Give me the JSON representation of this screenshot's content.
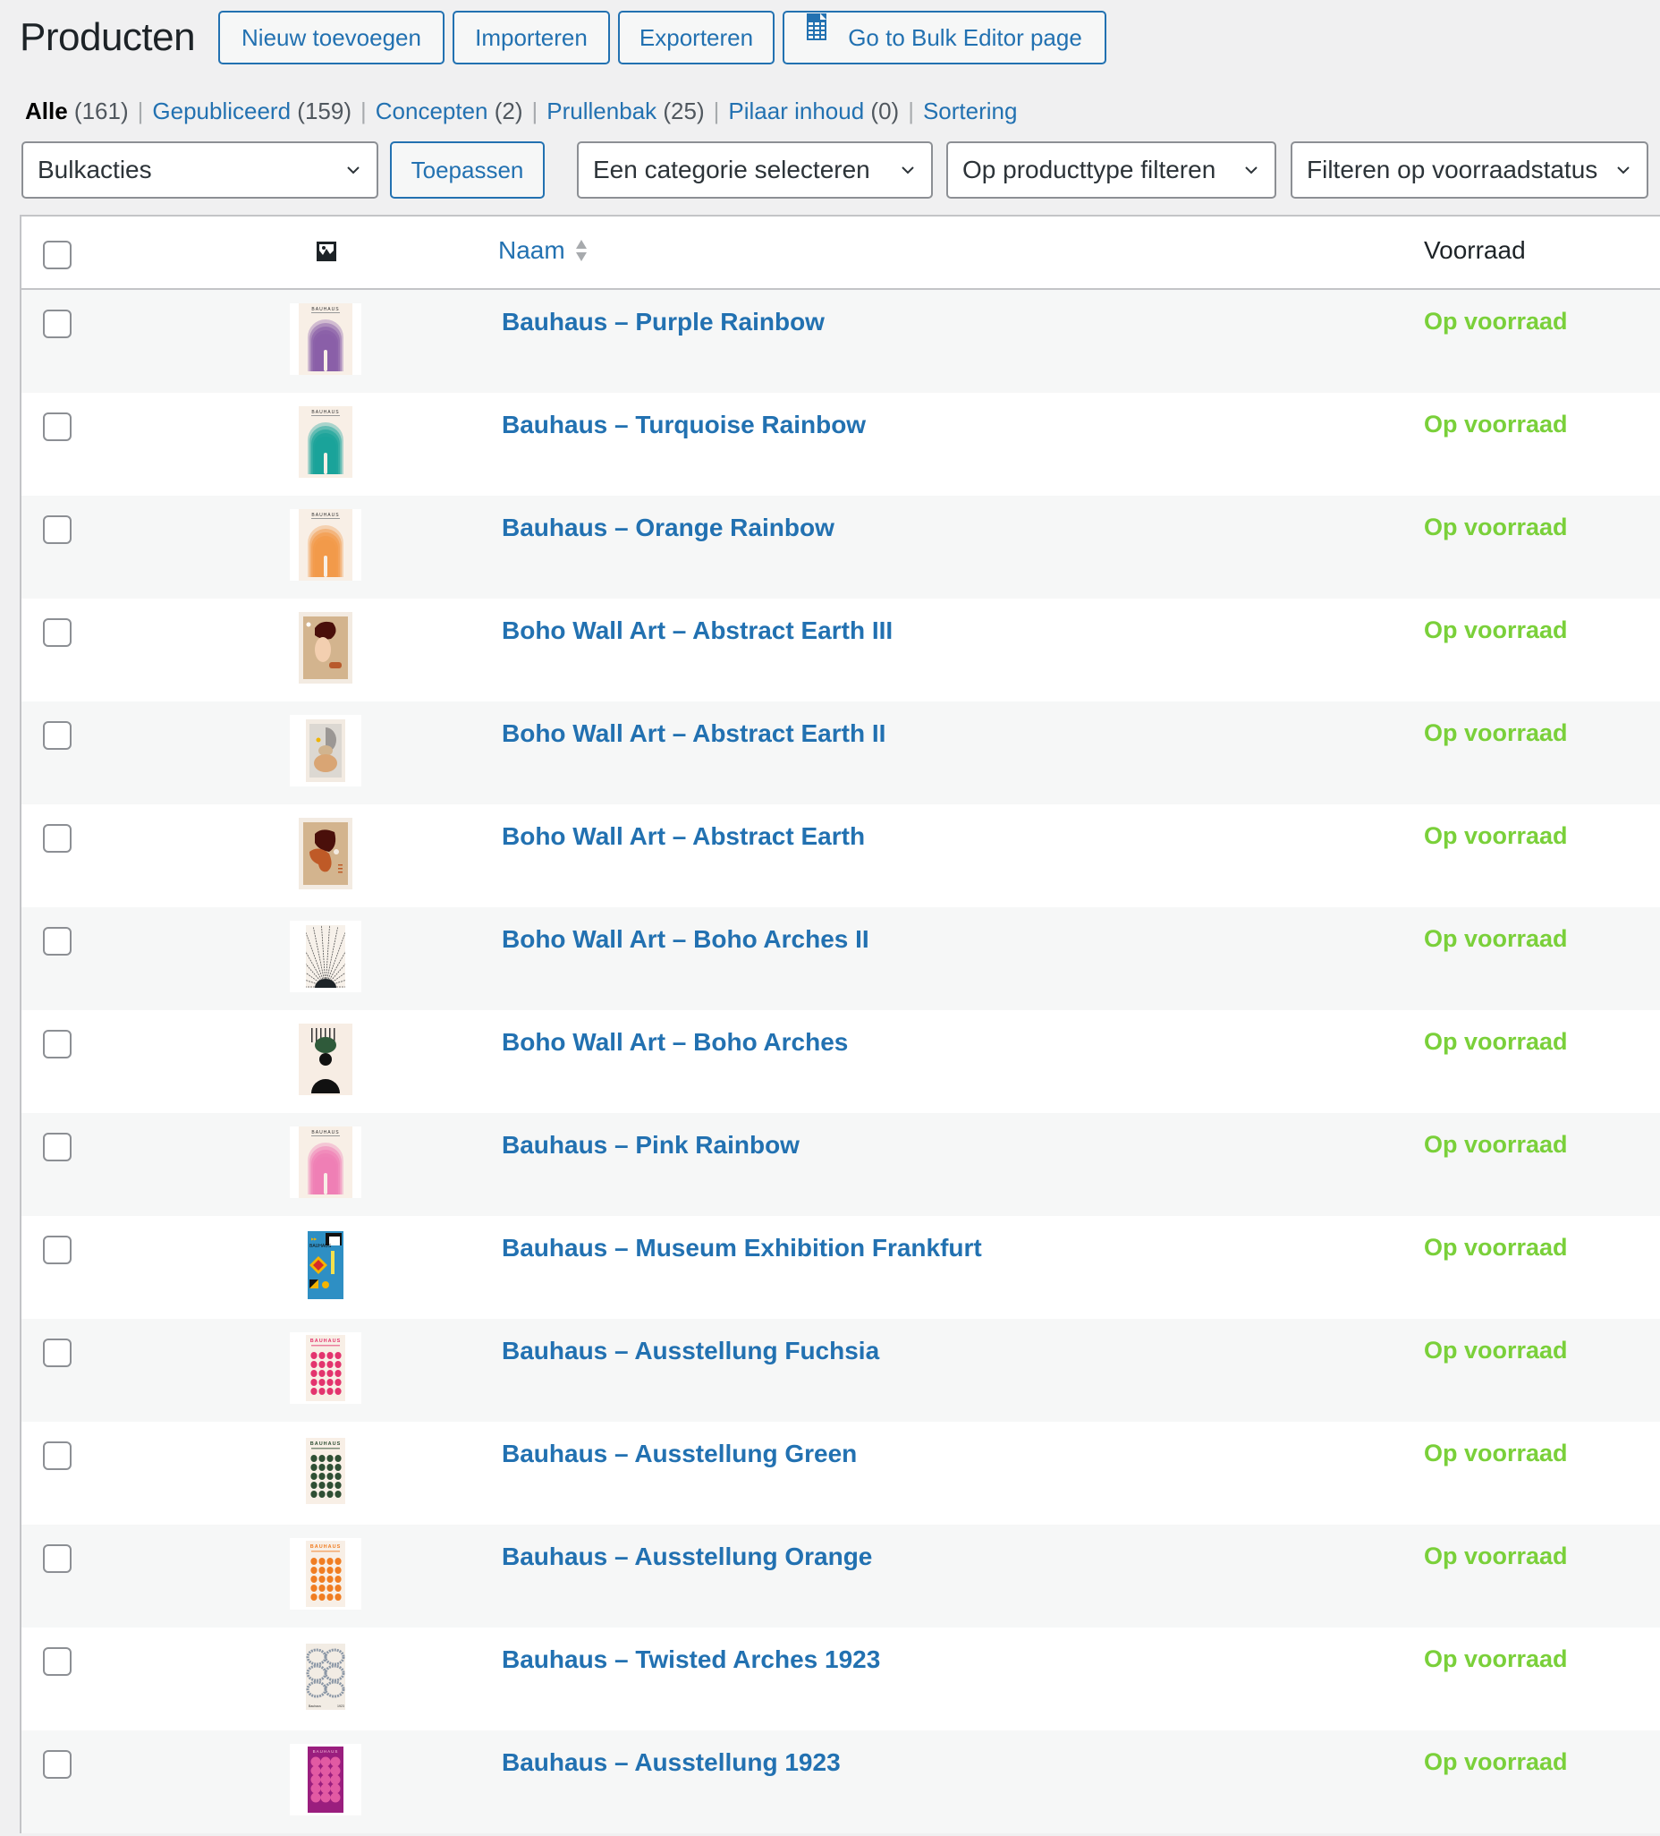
{
  "header": {
    "title": "Producten",
    "buttons": {
      "add_new": "Nieuw toevoegen",
      "import": "Importeren",
      "export": "Exporteren",
      "bulk_editor": "Go to Bulk Editor page",
      "bulk_editor_icon": "spreadsheet-icon"
    }
  },
  "views": [
    {
      "label": "Alle",
      "count": "(161)",
      "current": true
    },
    {
      "label": "Gepubliceerd",
      "count": "(159)"
    },
    {
      "label": "Concepten",
      "count": "(2)"
    },
    {
      "label": "Prullenbak",
      "count": "(25)"
    },
    {
      "label": "Pilaar inhoud",
      "count": "(0)"
    },
    {
      "label": "Sortering",
      "count": ""
    }
  ],
  "filters": {
    "bulk_actions": "Bulkacties",
    "apply": "Toepassen",
    "category": "Een categorie selecteren",
    "product_type": "Op producttype filteren",
    "stock_status": "Filteren op voorraadstatus"
  },
  "table": {
    "columns": {
      "image_icon": "image-icon",
      "name": "Naam",
      "stock": "Voorraad"
    },
    "rows": [
      {
        "name": "Bauhaus – Purple Rainbow",
        "stock": "Op voorraad",
        "thumb": "rainbow",
        "color": "#8a5fa8"
      },
      {
        "name": "Bauhaus – Turquoise Rainbow",
        "stock": "Op voorraad",
        "thumb": "rainbow",
        "color": "#1aa39a"
      },
      {
        "name": "Bauhaus – Orange Rainbow",
        "stock": "Op voorraad",
        "thumb": "rainbow",
        "color": "#f29a4a"
      },
      {
        "name": "Boho Wall Art – Abstract Earth III",
        "stock": "Op voorraad",
        "thumb": "earth3",
        "color": "#d3b48e"
      },
      {
        "name": "Boho Wall Art – Abstract Earth II",
        "stock": "Op voorraad",
        "thumb": "earth2",
        "color": "#dcd8d2"
      },
      {
        "name": "Boho Wall Art – Abstract Earth",
        "stock": "Op voorraad",
        "thumb": "earth1",
        "color": "#d3b48e"
      },
      {
        "name": "Boho Wall Art – Boho Arches II",
        "stock": "Op voorraad",
        "thumb": "sunburst",
        "color": "#1d2327"
      },
      {
        "name": "Boho Wall Art – Boho Arches",
        "stock": "Op voorraad",
        "thumb": "arches",
        "color": "#2f5a3a"
      },
      {
        "name": "Bauhaus – Pink Rainbow",
        "stock": "Op voorraad",
        "thumb": "rainbow",
        "color": "#ef7fb5"
      },
      {
        "name": "Bauhaus – Museum Exhibition Frankfurt",
        "stock": "Op voorraad",
        "thumb": "museum",
        "color": "#2e8fc4"
      },
      {
        "name": "Bauhaus – Ausstellung Fuchsia",
        "stock": "Op voorraad",
        "thumb": "dots",
        "color": "#e3346e"
      },
      {
        "name": "Bauhaus – Ausstellung Green",
        "stock": "Op voorraad",
        "thumb": "dots",
        "color": "#2f4f34"
      },
      {
        "name": "Bauhaus – Ausstellung Orange",
        "stock": "Op voorraad",
        "thumb": "dots",
        "color": "#f07d22"
      },
      {
        "name": "Bauhaus – Twisted Arches 1923",
        "stock": "Op voorraad",
        "thumb": "twisted",
        "color": "#8b97a6"
      },
      {
        "name": "Bauhaus – Ausstellung 1923",
        "stock": "Op voorraad",
        "thumb": "magenta",
        "color": "#9a1e7e"
      }
    ]
  },
  "colors": {
    "link": "#2271b1",
    "in_stock": "#7ad03a",
    "background": "#f0f0f1"
  }
}
